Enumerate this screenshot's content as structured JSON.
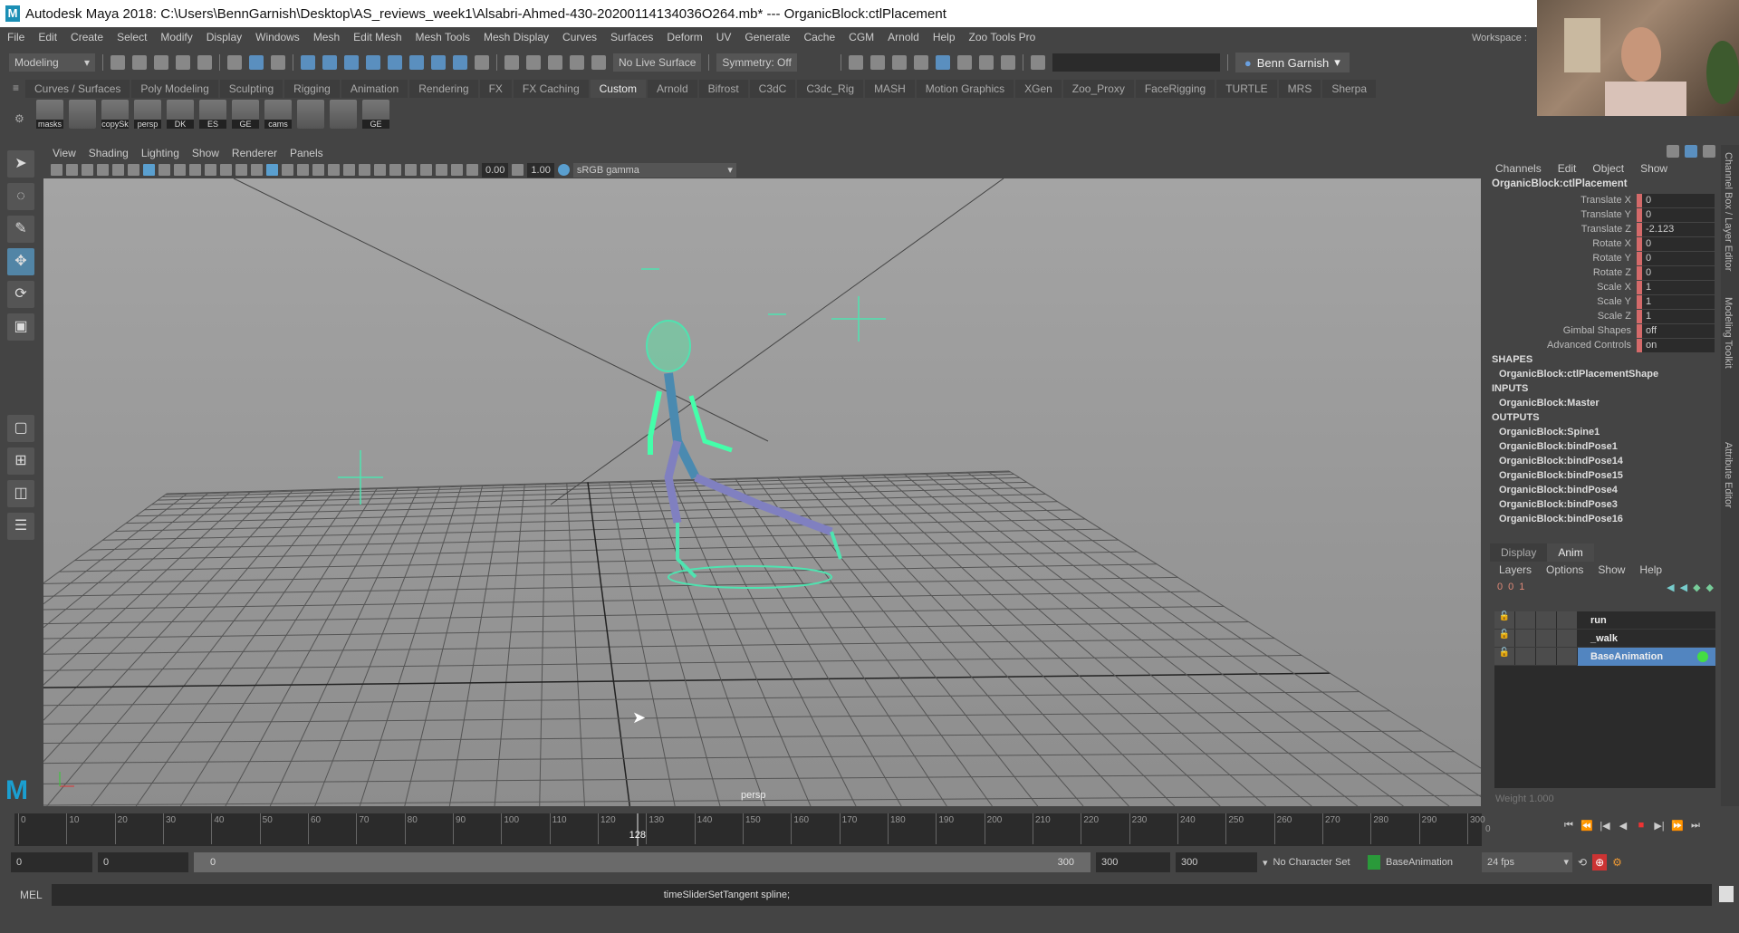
{
  "title_bar": {
    "text": "Autodesk Maya 2018: C:\\Users\\BennGarnish\\Desktop\\AS_reviews_week1\\Alsabri-Ahmed-430-20200114134036O264.mb*  ---   OrganicBlock:ctlPlacement",
    "logo": "M"
  },
  "menu": [
    "File",
    "Edit",
    "Create",
    "Select",
    "Modify",
    "Display",
    "Windows",
    "Mesh",
    "Edit Mesh",
    "Mesh Tools",
    "Mesh Display",
    "Curves",
    "Surfaces",
    "Deform",
    "UV",
    "Generate",
    "Cache",
    "CGM",
    "Arnold",
    "Help",
    "Zoo Tools Pro"
  ],
  "workspace_label": "Workspace :",
  "status_line": {
    "mode": "Modeling",
    "live_surface": "No Live Surface",
    "symmetry": "Symmetry: Off",
    "user": "Benn Garnish"
  },
  "shelf_tabs": [
    "Curves / Surfaces",
    "Poly Modeling",
    "Sculpting",
    "Rigging",
    "Animation",
    "Rendering",
    "FX",
    "FX Caching",
    "Custom",
    "Arnold",
    "Bifrost",
    "C3dC",
    "C3dc_Rig",
    "MASH",
    "Motion Graphics",
    "XGen",
    "Zoo_Proxy",
    "FaceRigging",
    "TURTLE",
    "MRS",
    "Sherpa"
  ],
  "shelf_active": "Custom",
  "shelf_items": [
    "masks",
    "",
    "copySk",
    "persp",
    "DK",
    "ES",
    "GE",
    "cams",
    "",
    "",
    "GE"
  ],
  "viewport": {
    "menu": [
      "View",
      "Shading",
      "Lighting",
      "Show",
      "Renderer",
      "Panels"
    ],
    "exposure": "0.00",
    "gamma": "1.00",
    "color_space": "sRGB gamma",
    "camera": "persp"
  },
  "channel_box": {
    "menu": [
      "Channels",
      "Edit",
      "Object",
      "Show"
    ],
    "node": "OrganicBlock:ctlPlacement",
    "channels": [
      {
        "label": "Translate X",
        "value": "0"
      },
      {
        "label": "Translate Y",
        "value": "0"
      },
      {
        "label": "Translate Z",
        "value": "-2.123"
      },
      {
        "label": "Rotate X",
        "value": "0"
      },
      {
        "label": "Rotate Y",
        "value": "0"
      },
      {
        "label": "Rotate Z",
        "value": "0"
      },
      {
        "label": "Scale X",
        "value": "1"
      },
      {
        "label": "Scale Y",
        "value": "1"
      },
      {
        "label": "Scale Z",
        "value": "1"
      },
      {
        "label": "Gimbal Shapes",
        "value": "off"
      },
      {
        "label": "Advanced Controls",
        "value": "on"
      }
    ],
    "shapes_label": "SHAPES",
    "shapes": [
      "OrganicBlock:ctlPlacementShape"
    ],
    "inputs_label": "INPUTS",
    "inputs": [
      "OrganicBlock:Master"
    ],
    "outputs_label": "OUTPUTS",
    "outputs": [
      "OrganicBlock:Spine1",
      "OrganicBlock:bindPose1",
      "OrganicBlock:bindPose14",
      "OrganicBlock:bindPose15",
      "OrganicBlock:bindPose4",
      "OrganicBlock:bindPose3",
      "OrganicBlock:bindPose16"
    ]
  },
  "layer_editor": {
    "tabs": [
      "Display",
      "Anim"
    ],
    "active_tab": "Anim",
    "menu": [
      "Layers",
      "Options",
      "Show",
      "Help"
    ],
    "layers": [
      {
        "name": "run",
        "selected": false
      },
      {
        "name": "_walk",
        "selected": false
      },
      {
        "name": "BaseAnimation",
        "selected": true
      }
    ],
    "weight_label": "Weight",
    "weight": "1.000"
  },
  "side_tabs": [
    "Channel Box / Layer Editor",
    "Modeling Toolkit",
    "Attribute Editor"
  ],
  "timeline": {
    "start": 0,
    "end": 300,
    "tick_step": 10,
    "current_frame": 128,
    "end_label": "0"
  },
  "range": {
    "start": "0",
    "playback_start": "0",
    "slider_start": "0",
    "slider_end": "300",
    "playback_end": "300",
    "end": "300",
    "character_set": "No Character Set",
    "anim_layer": "BaseAnimation",
    "fps": "24 fps"
  },
  "command_line": {
    "label": "MEL",
    "text": "timeSliderSetTangent spline;"
  },
  "colors": {
    "accent": "#5285c0",
    "key": "#d46a6a",
    "wire": "#4fe3b0"
  }
}
